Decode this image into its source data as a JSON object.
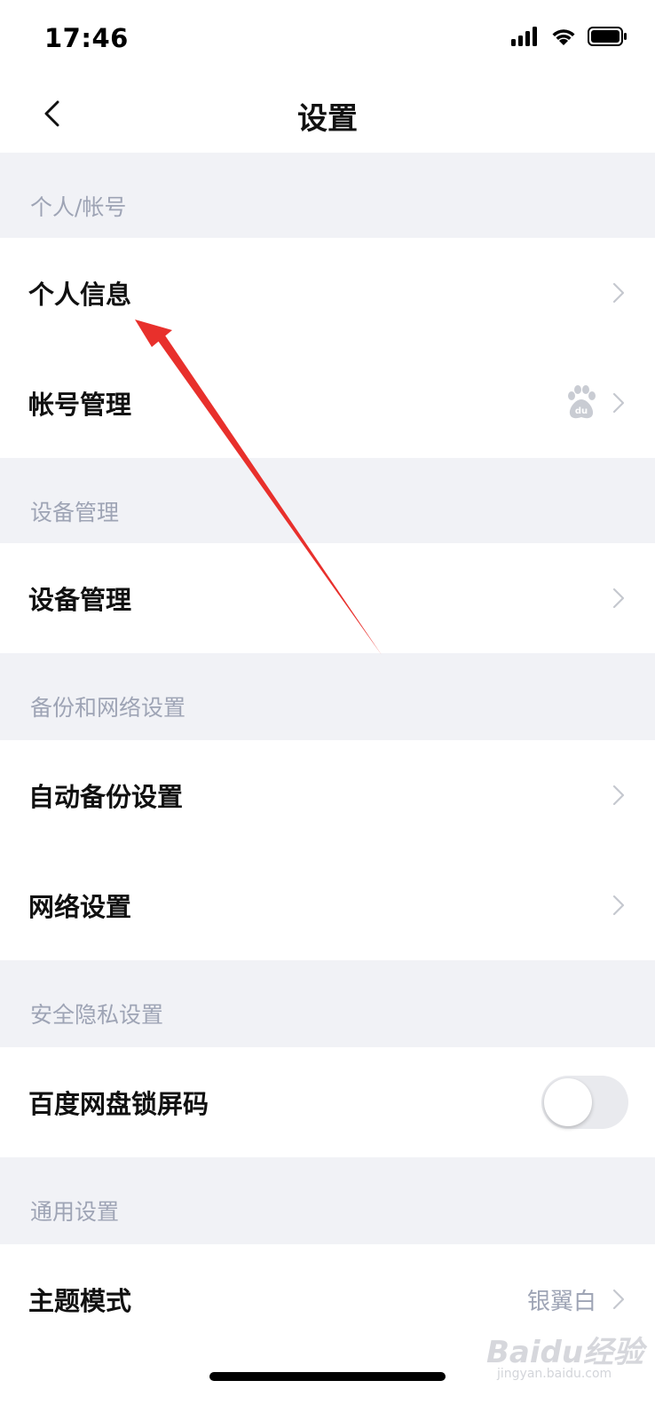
{
  "status_bar": {
    "time": "17:46"
  },
  "nav": {
    "title": "设置"
  },
  "sections": [
    {
      "header": "个人/帐号",
      "items": [
        {
          "label": "个人信息"
        },
        {
          "label": "帐号管理"
        }
      ]
    },
    {
      "header": "设备管理",
      "items": [
        {
          "label": "设备管理"
        }
      ]
    },
    {
      "header": "备份和网络设置",
      "items": [
        {
          "label": "自动备份设置"
        },
        {
          "label": "网络设置"
        }
      ]
    },
    {
      "header": "安全隐私设置",
      "items": [
        {
          "label": "百度网盘锁屏码",
          "toggle": false
        }
      ]
    },
    {
      "header": "通用设置",
      "items": [
        {
          "label": "主题模式",
          "value": "银翼白"
        }
      ]
    }
  ],
  "watermark": {
    "text": "Baidu经验",
    "sub": "jingyan.baidu.com"
  },
  "colors": {
    "background": "#f1f2f6",
    "section_header_text": "#9ea4b5",
    "annotation_arrow": "#e8302c"
  }
}
